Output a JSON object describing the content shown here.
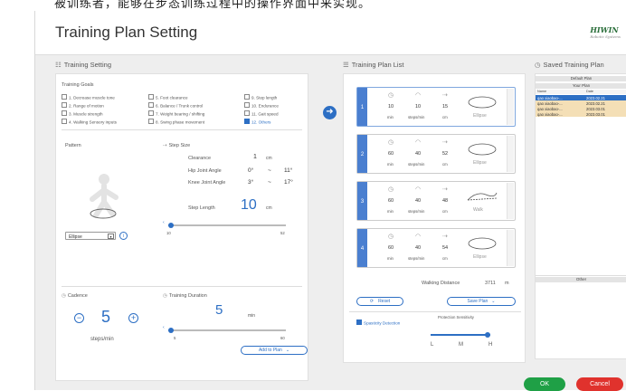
{
  "top_strip": "被训练者，能够在步态训练过程中的操作界面中来实现。",
  "window": {
    "title": "Training Plan Setting",
    "logo": "HIWIN",
    "logo_sub": "Robotic Systems"
  },
  "training_setting": {
    "title": "Training Setting",
    "goals_label": "Training Goals",
    "goals": [
      {
        "label": "1. Decrease muscle tone",
        "checked": false
      },
      {
        "label": "2. Range of motion",
        "checked": false
      },
      {
        "label": "3. Muscle strength",
        "checked": false
      },
      {
        "label": "4. Walking Sensory inputs",
        "checked": false
      },
      {
        "label": "5. Foot clearance",
        "checked": false
      },
      {
        "label": "6. Balance / Trunk control",
        "checked": false
      },
      {
        "label": "7. Weight bearing / shifting",
        "checked": false
      },
      {
        "label": "8. Swing phase movement",
        "checked": false
      },
      {
        "label": "9. Step length",
        "checked": false
      },
      {
        "label": "10. Endurance",
        "checked": false
      },
      {
        "label": "11. Gait speed",
        "checked": false
      },
      {
        "label": "12. Others",
        "checked": true
      }
    ],
    "pattern_label": "Pattern",
    "pattern_value": "Ellipse",
    "step_size_label": "Step Size",
    "clearance_label": "Clearance",
    "clearance_value": "1",
    "clearance_unit": "cm",
    "hip_label": "Hip Joint Angle",
    "hip_from": "0°",
    "hip_to": "11°",
    "knee_label": "Knee Joint Angle",
    "knee_from": "3°",
    "knee_to": "17°",
    "dash": "~",
    "step_length_label": "Step Length",
    "step_length_value": "10",
    "step_length_unit": "cm",
    "step_min": "10",
    "step_max": "52",
    "step_fraction": 0.0,
    "cadence_label": "Cadence",
    "cadence_value": "5",
    "cadence_unit": "steps/min",
    "minus": "−",
    "plus": "+",
    "duration_label": "Training Duration",
    "duration_value": "5",
    "duration_unit": "min",
    "duration_min": "5",
    "duration_max": "60",
    "duration_fraction": 0.0,
    "add_to_plan": "Add to Plan"
  },
  "plan_list": {
    "title": "Training Plan List",
    "segments": [
      {
        "num": "1",
        "min": "10",
        "spm": "10",
        "cm": "15",
        "shape": "Ellipse"
      },
      {
        "num": "2",
        "min": "60",
        "spm": "40",
        "cm": "52",
        "shape": "Ellipse"
      },
      {
        "num": "3",
        "min": "60",
        "spm": "40",
        "cm": "48",
        "shape": "Walk"
      },
      {
        "num": "4",
        "min": "60",
        "spm": "40",
        "cm": "54",
        "shape": "Ellipse"
      }
    ],
    "unit_min": "min",
    "unit_spm": "steps/min",
    "unit_cm": "cm",
    "walking_distance_label": "Walking Distance",
    "walking_distance_value": "3711",
    "walking_distance_unit": "m",
    "reset": "Reset",
    "save_plan": "Save Plan",
    "spasticity_label": "Spasticity Detection",
    "sensitivity_label": "Protection Sensitivity",
    "sensitivity_levels": [
      "L",
      "M",
      "H"
    ],
    "sensitivity_fraction": 1.0
  },
  "saved": {
    "title": "Saved Training Plan",
    "default_plan": "Default Plan",
    "your_plan": "Your Plan",
    "col_name": "Name",
    "col_date": "Date",
    "rows": [
      {
        "name": "qao  xiaobao-...",
        "date": "2023.02.21",
        "selected": true
      },
      {
        "name": "qao  xiaobao-...",
        "date": "2023.02.21",
        "selected": false
      },
      {
        "name": "qao  xiaobao-...",
        "date": "2023.03.01",
        "selected": false
      },
      {
        "name": "qao  xiaobao-...",
        "date": "2023.03.01",
        "selected": false
      }
    ],
    "other": "Other"
  },
  "actions": {
    "ok": "OK",
    "cancel": "Cancel"
  }
}
